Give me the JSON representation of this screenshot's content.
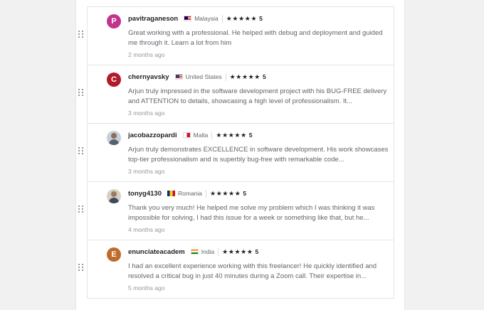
{
  "reviews": [
    {
      "username": "pavitraganeson",
      "avatar_letter": "P",
      "avatar_color": "#c2338b",
      "flag": "flag-my",
      "country": "Malaysia",
      "rating": "5",
      "stars": "★★★★★",
      "text": "Great working with a professional. He helped with debug and deployment and guided me through it. Learn a lot from him",
      "time": "2 months ago"
    },
    {
      "username": "chernyavsky",
      "avatar_letter": "C",
      "avatar_color": "#b2192b",
      "flag": "flag-us",
      "country": "United States",
      "rating": "5",
      "stars": "★★★★★",
      "text": "Arjun truly impressed in the software development project with his BUG-FREE delivery and ATTENTION to details, showcasing a high level of professionalism. It...",
      "time": "3 months ago"
    },
    {
      "username": "jacobazzopardi",
      "avatar_letter": "",
      "avatar_color": "#c9ced6",
      "flag": "flag-mt",
      "country": "Malta",
      "rating": "5",
      "stars": "★★★★★",
      "text": "Arjun truly demonstrates EXCELLENCE in software development. His work showcases top-tier professionalism and is superbly bug-free with remarkable code...",
      "time": "3 months ago"
    },
    {
      "username": "tonyg4130",
      "avatar_letter": "",
      "avatar_color": "#c9ced6",
      "flag": "flag-ro",
      "country": "Romania",
      "rating": "5",
      "stars": "★★★★★",
      "text": "Thank you very much! He helped me solve my problem which I was thinking it was impossible for solving, I had this issue for a week or something like that, but he...",
      "time": "4 months ago"
    },
    {
      "username": "enunciateacadem",
      "avatar_letter": "E",
      "avatar_color": "#c06a2b",
      "flag": "flag-in",
      "country": "India",
      "rating": "5",
      "stars": "★★★★★",
      "text": "I had an excellent experience working with this freelancer! He quickly identified and resolved a critical bug in just 40 minutes during a Zoom call. Their expertise in...",
      "time": "5 months ago"
    }
  ]
}
